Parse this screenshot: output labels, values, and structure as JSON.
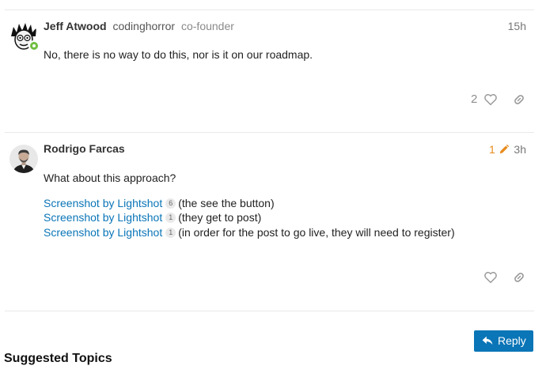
{
  "posts": [
    {
      "author_name": "Jeff Atwood",
      "username": "codinghorror",
      "user_title": "co-founder",
      "time": "15h",
      "body": "No, there is no way to do this, nor is it on our roadmap.",
      "like_count": "2"
    },
    {
      "author_name": "Rodrigo Farcas",
      "edit_count": "1",
      "time": "3h",
      "body": "What about this approach?",
      "links": [
        {
          "text": "Screenshot by Lightshot",
          "clicks": "6",
          "suffix": "(the see the button)"
        },
        {
          "text": "Screenshot by Lightshot",
          "clicks": "1",
          "suffix": "(they get to post)"
        },
        {
          "text": "Screenshot by Lightshot",
          "clicks": "1",
          "suffix": "(in order for the post to go live, they will need to register)"
        }
      ]
    }
  ],
  "reply_label": "Reply",
  "suggested_heading": "Suggested Topics",
  "colors": {
    "link": "#0a75b7",
    "reply_button": "#0a75b7",
    "edit_indicator": "#e88b1d",
    "divider": "#e9e9e9"
  },
  "icons": [
    "heart-icon",
    "link-icon",
    "pencil-icon",
    "reply-icon"
  ]
}
